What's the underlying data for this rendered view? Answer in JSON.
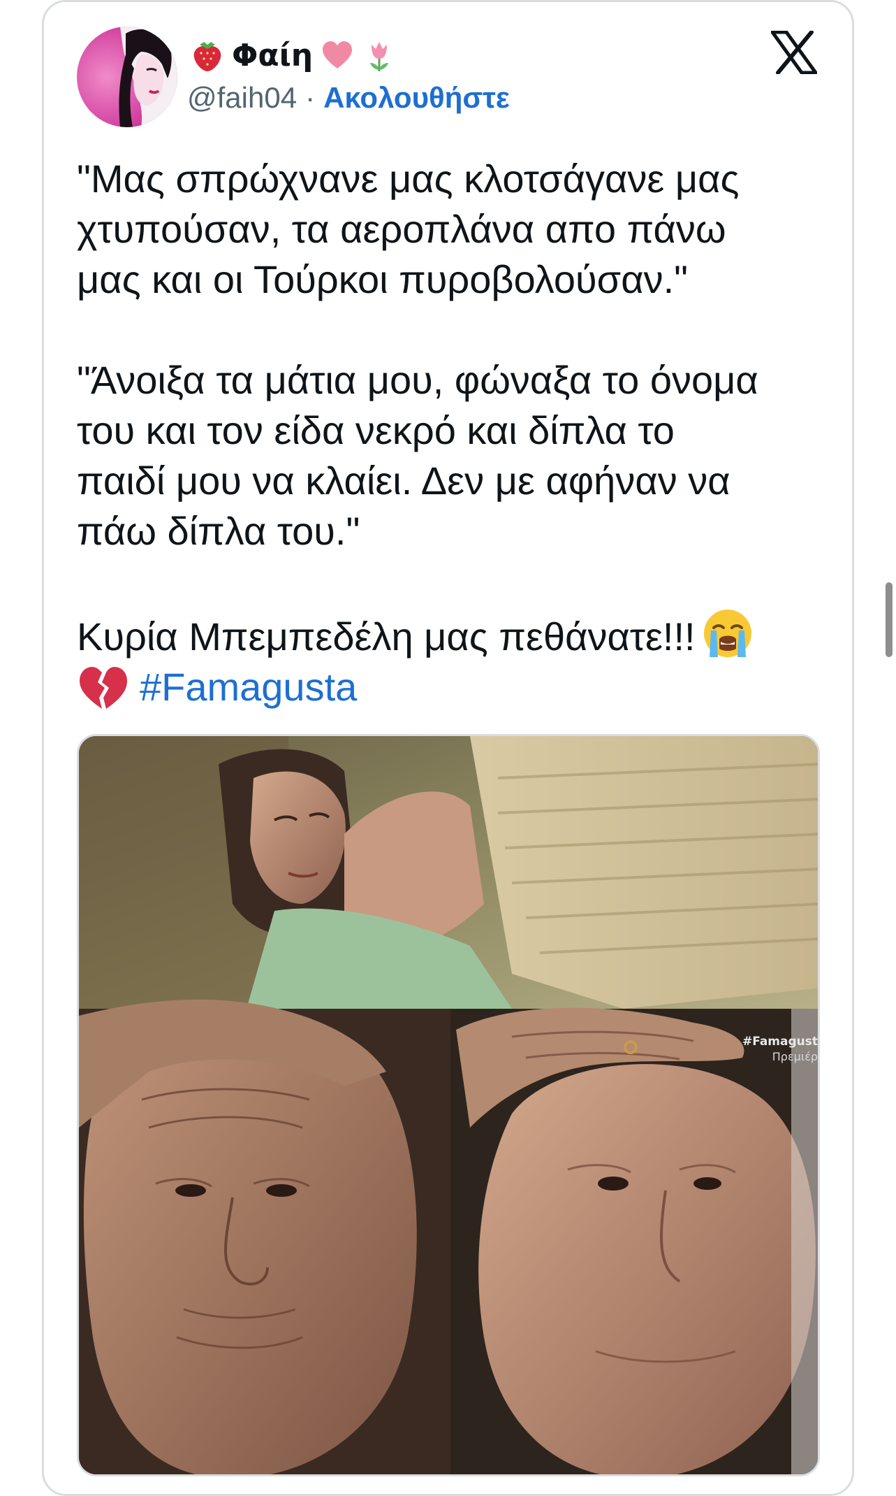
{
  "user": {
    "display_name": "Φαίη",
    "handle": "@faih04",
    "separator": "·",
    "follow_label": "Ακολουθήστε"
  },
  "tweet": {
    "paragraph1": "\"Μας σπρώχνανε μας κλοτσάγανε μας\nχτυπούσαν, τα αεροπλάνα απο πάνω\nμας και οι Τούρκοι πυροβολούσαν.\"",
    "paragraph2": "\"Άνοιξα τα μάτια μου, φώναξα το όνομα\nτου και τον είδα νεκρό και δίπλα το\nπαιδί μου να κλαίει. Δεν με αφήναν να\nπάω δίπλα του.\"",
    "paragraph3": "Κυρία Μπεμπεδέλη μας πεθάνατε!!!",
    "hashtag": "#Famagusta"
  },
  "media": {
    "watermark_tag": "#Famagust",
    "watermark_sub": "Πρεμιέρ"
  },
  "icons": {
    "x_logo": "x-logo-icon",
    "emoji_name_1": "strawberry",
    "emoji_name_2": "pink-heart",
    "emoji_name_3": "tulip",
    "emoji_text_1": "loudly-crying-face",
    "emoji_text_2": "broken-heart"
  },
  "colors": {
    "link": "#1d6fd1",
    "muted": "#536471",
    "text": "#0f1419",
    "border": "#dadde0"
  }
}
